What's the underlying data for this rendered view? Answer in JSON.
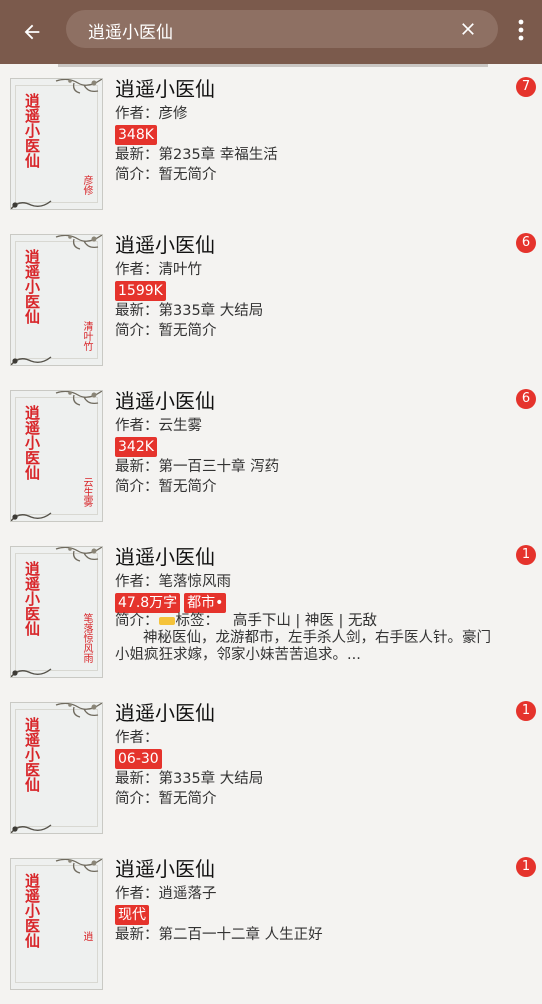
{
  "search": {
    "query": "逍遥小医仙"
  },
  "labels": {
    "author_prefix": "作者：",
    "latest_prefix": "最新：",
    "intro_prefix": "简介："
  },
  "colors": {
    "appbar": "#7b5a4c",
    "accent": "#e5332c"
  },
  "icons": {
    "back": "arrow-left-icon",
    "clear": "close-icon",
    "more": "more-vert-icon"
  },
  "results": [
    {
      "title": "逍遥小医仙",
      "cover_title": "逍遥小医仙",
      "cover_author": "彦修",
      "author": "彦修",
      "tags": [
        "348K"
      ],
      "latest": "第235章 幸福生活",
      "intro": "暂无简介",
      "badge": "7"
    },
    {
      "title": "逍遥小医仙",
      "cover_title": "逍遥小医仙",
      "cover_author": "清叶竹",
      "author": "清叶竹",
      "tags": [
        "1599K"
      ],
      "latest": "第335章 大结局",
      "intro": "暂无简介",
      "badge": "6"
    },
    {
      "title": "逍遥小医仙",
      "cover_title": "逍遥小医仙",
      "cover_author": "云生雾",
      "author": "云生雾",
      "tags": [
        "342K"
      ],
      "latest": "第一百三十章 泻药",
      "intro": "暂无简介",
      "badge": "6"
    },
    {
      "title": "逍遥小医仙",
      "cover_title": "逍遥小医仙",
      "cover_author": "笔落惊风雨",
      "author": "笔落惊风雨",
      "tags": [
        "47.8万字",
        "都市•"
      ],
      "intro_label": "标签：",
      "intro_tags": "高手下山 | 神医 | 无敌",
      "intro_body": "神秘医仙，龙游都市，左手杀人剑，右手医人针。豪门小姐疯狂求嫁，邻家小妹苦苦追求。...",
      "badge": "1"
    },
    {
      "title": "逍遥小医仙",
      "cover_title": "逍遥小医仙",
      "cover_author": "",
      "author": "",
      "tags": [
        "06-30"
      ],
      "latest": "第335章 大结局",
      "intro": "暂无简介",
      "badge": "1"
    },
    {
      "title": "逍遥小医仙",
      "cover_title": "逍遥小医仙",
      "cover_author": "逍",
      "author": "逍遥落子",
      "tags": [
        "现代"
      ],
      "latest": "第二百一十二章 人生正好",
      "intro": "",
      "badge": "1"
    }
  ]
}
